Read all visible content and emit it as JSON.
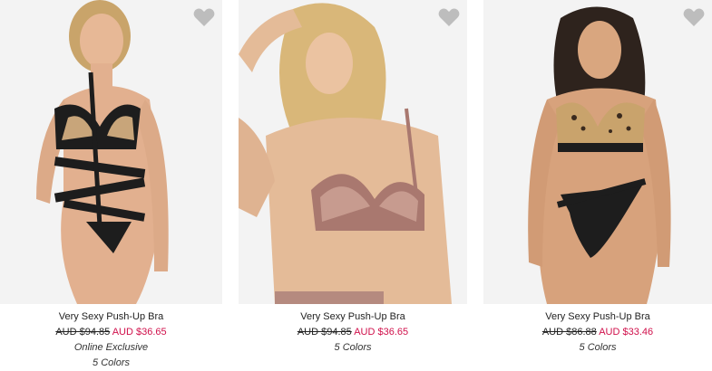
{
  "products": [
    {
      "name": "Very Sexy Push-Up Bra",
      "old_price": "AUD $94.85",
      "sale_price": "AUD $36.65",
      "badge": "Online Exclusive",
      "colors": "5 Colors",
      "icon": "heart-icon"
    },
    {
      "name": "Very Sexy Push-Up Bra",
      "old_price": "AUD $94.85",
      "sale_price": "AUD $36.65",
      "colors": "5 Colors",
      "icon": "heart-icon"
    },
    {
      "name": "Very Sexy Push-Up Bra",
      "old_price": "AUD $86.88",
      "sale_price": "AUD $33.46",
      "colors": "5 Colors",
      "icon": "heart-icon"
    }
  ],
  "colors": {
    "sale": "#d0104b",
    "heart": "#bdbdbd",
    "background": "#f2f2f2"
  }
}
